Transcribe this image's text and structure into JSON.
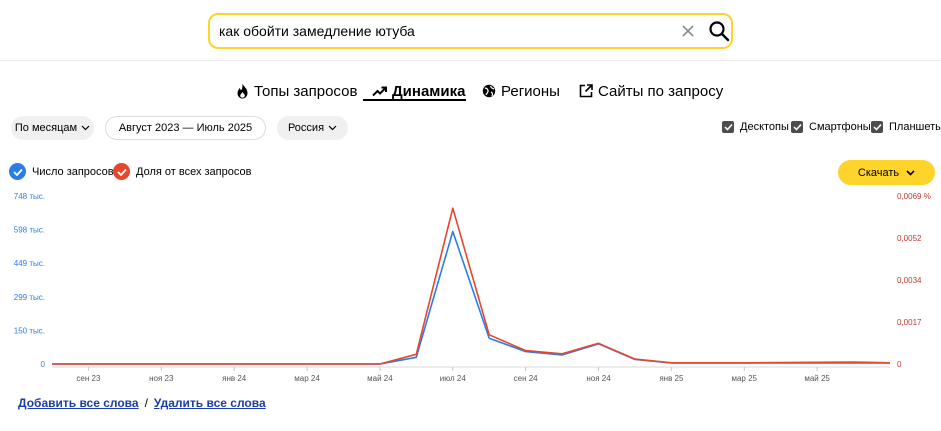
{
  "search": {
    "value": "как обойти замедление ютуба"
  },
  "tabs": [
    {
      "label": "Топы запросов",
      "icon": "fire-icon"
    },
    {
      "label": "Динамика",
      "icon": "trend-icon",
      "active": true
    },
    {
      "label": "Регионы",
      "icon": "globe-icon"
    },
    {
      "label": "Сайты по запросу",
      "icon": "external-link-icon"
    }
  ],
  "filters": {
    "period_type": "По месяцам",
    "date_range": "Август 2023 — Июль 2025",
    "region": "Россия"
  },
  "devices": [
    {
      "label": "Десктопы",
      "checked": true
    },
    {
      "label": "Смартфоны",
      "checked": true
    },
    {
      "label": "Планшеты",
      "checked": true
    }
  ],
  "legend": [
    {
      "label": "Число запросов",
      "color": "#2b7de9"
    },
    {
      "label": "Доля от всех запросов",
      "color": "#e8452c"
    }
  ],
  "download_label": "Скачать",
  "chart_data": {
    "type": "line",
    "x": [
      "авг 23",
      "сен 23",
      "окт 23",
      "ноя 23",
      "дек 23",
      "янв 24",
      "фев 24",
      "мар 24",
      "апр 24",
      "май 24",
      "июн 24",
      "июл 24",
      "авг 24",
      "сен 24",
      "окт 24",
      "ноя 24",
      "дек 24",
      "янв 25",
      "фев 25",
      "мар 25",
      "апр 25",
      "май 25",
      "июн 25",
      "июл 25"
    ],
    "x_tick_labels": [
      "сен 23",
      "ноя 23",
      "янв 24",
      "мар 24",
      "май 24",
      "июл 24",
      "сен 24",
      "ноя 24",
      "янв 25",
      "мар 25",
      "май 25"
    ],
    "y_left": {
      "ticks": [
        "0",
        "150 тыс.",
        "299 тыс.",
        "449 тыс.",
        "598 тыс.",
        "748 тыс."
      ],
      "range": [
        0,
        748000
      ],
      "color": "#2b7de9"
    },
    "y_right": {
      "ticks": [
        "0",
        "0,0017",
        "0,0034",
        "0,0052",
        "0,0069 %"
      ],
      "range": [
        0,
        0.0069
      ],
      "color": "#c0392b"
    },
    "series": [
      {
        "name": "Число запросов",
        "axis": "left",
        "color": "#2b7de9",
        "values": [
          0,
          0,
          0,
          0,
          0,
          0,
          0,
          0,
          0,
          0,
          30000,
          590000,
          115000,
          55000,
          40000,
          90000,
          20000,
          5000,
          5000,
          5000,
          5000,
          5000,
          5000,
          5000
        ]
      },
      {
        "name": "Доля от всех запросов",
        "axis": "right",
        "color": "#e8452c",
        "values": [
          0,
          0,
          0,
          0,
          0,
          0,
          0,
          0,
          0,
          0,
          0.0004,
          0.0064,
          0.0012,
          0.00055,
          0.00042,
          0.00085,
          0.0002,
          5e-05,
          5e-05,
          5e-05,
          6e-05,
          7e-05,
          8e-05,
          5e-05
        ]
      }
    ],
    "grid": false
  },
  "actions": {
    "add_all": "Добавить все слова",
    "separator": "/",
    "remove_all": "Удалить все слова"
  }
}
